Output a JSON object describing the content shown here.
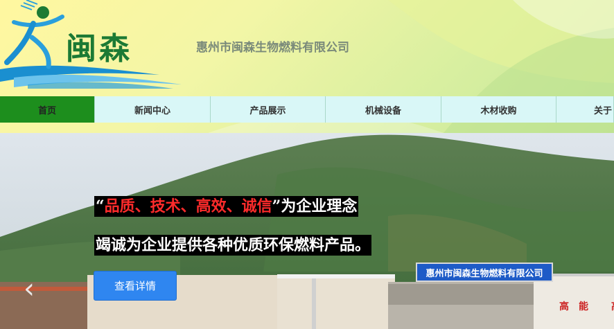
{
  "header": {
    "logo_text": "闽森",
    "company_name": "惠州市闽森生物燃料有限公司"
  },
  "nav": {
    "items": [
      {
        "label": "首页"
      },
      {
        "label": "新闻中心"
      },
      {
        "label": "产品展示"
      },
      {
        "label": "机械设备"
      },
      {
        "label": "木材收购"
      },
      {
        "label": "关于"
      }
    ]
  },
  "banner": {
    "slogan1_open_quote": "“",
    "slogan1_highlight": "品质、技术、高效、诚信",
    "slogan1_rest": "”为企业理念",
    "slogan2": "竭诚为企业提供各种优质环保燃料产品。",
    "detail_button": "查看详情",
    "prev_arrow": "‹",
    "sign_text": "惠州市闽森生物燃料有限公司",
    "wall_text": "高能 高",
    "colors": {
      "highlight": "#ff2b2b",
      "button": "#2f86f0",
      "nav_active": "#1d8e1d"
    }
  }
}
